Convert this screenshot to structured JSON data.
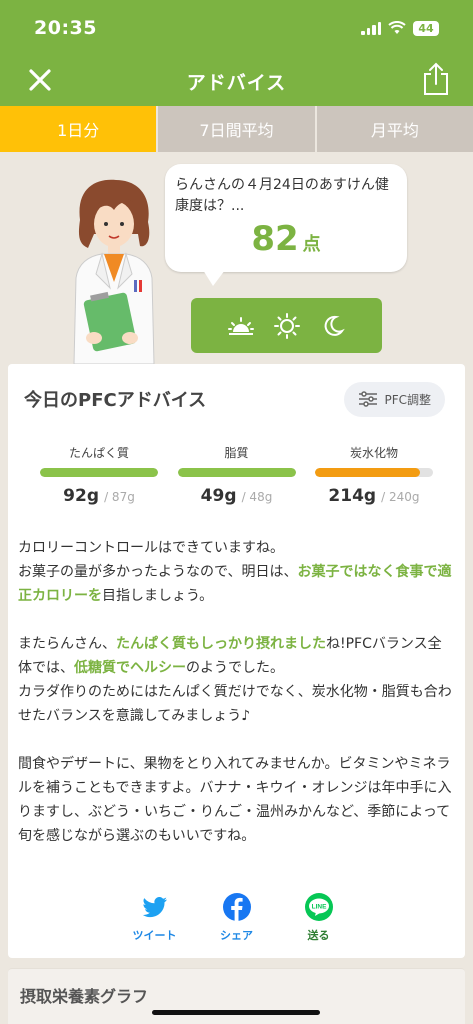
{
  "status_bar": {
    "time": "20:35",
    "battery": "44"
  },
  "header": {
    "title": "アドバイス"
  },
  "tabs": [
    {
      "label": "1日分",
      "active": true
    },
    {
      "label": "7日間平均",
      "active": false
    },
    {
      "label": "月平均",
      "active": false
    }
  ],
  "bubble": {
    "question": "らんさんの４月24日のあすけん健康度は？...",
    "score": "82",
    "unit": "点"
  },
  "time_icons": [
    "sunrise-icon",
    "sun-icon",
    "moon-icon"
  ],
  "advice_card": {
    "title": "今日のPFCアドバイス",
    "pfc_button": "PFC調整",
    "nutrients": [
      {
        "label": "たんぱく質",
        "value": "92g",
        "target": "/ 87g",
        "fill": 1.0,
        "color": "#8bc34a"
      },
      {
        "label": "脂質",
        "value": "49g",
        "target": "/ 48g",
        "fill": 1.0,
        "color": "#8bc34a"
      },
      {
        "label": "炭水化物",
        "value": "214g",
        "target": "/ 240g",
        "fill": 0.89,
        "color": "#f39c12"
      }
    ],
    "paragraphs": [
      [
        {
          "text": "カロリーコントロールはできていますね。\nお菓子の量が多かったようなので、明日は、",
          "hl": false
        },
        {
          "text": "お菓子ではなく食事で適正カロリーを",
          "hl": true
        },
        {
          "text": "目指しましょう。",
          "hl": false
        }
      ],
      [
        {
          "text": "またらんさん、",
          "hl": false
        },
        {
          "text": "たんぱく質もしっかり摂れました",
          "hl": true
        },
        {
          "text": "ね!PFCバランス全体では、",
          "hl": false
        },
        {
          "text": "低糖質でヘルシー",
          "hl": true
        },
        {
          "text": "のようでした。\nカラダ作りのためにはたんぱく質だけでなく、炭水化物・脂質も合わせたバランスを意識してみましょう♪",
          "hl": false
        }
      ],
      [
        {
          "text": "間食やデザートに、果物をとり入れてみませんか。ビタミンやミネラルを補うこともできますよ。バナナ・キウイ・オレンジは年中手に入りますし、ぶどう・いちご・りんご・温州みかんなど、季節によって旬を感じながら選ぶのもいいですね。",
          "hl": false
        }
      ]
    ],
    "social": [
      {
        "label": "ツイート",
        "icon": "twitter-icon"
      },
      {
        "label": "シェア",
        "icon": "facebook-icon"
      },
      {
        "label": "送る",
        "icon": "line-icon"
      }
    ]
  },
  "graph_card": {
    "title": "摂取栄養素グラフ"
  },
  "colors": {
    "brand_green": "#7cb342",
    "tab_active": "#ffc107",
    "tab_inactive": "#ccc5bd"
  }
}
